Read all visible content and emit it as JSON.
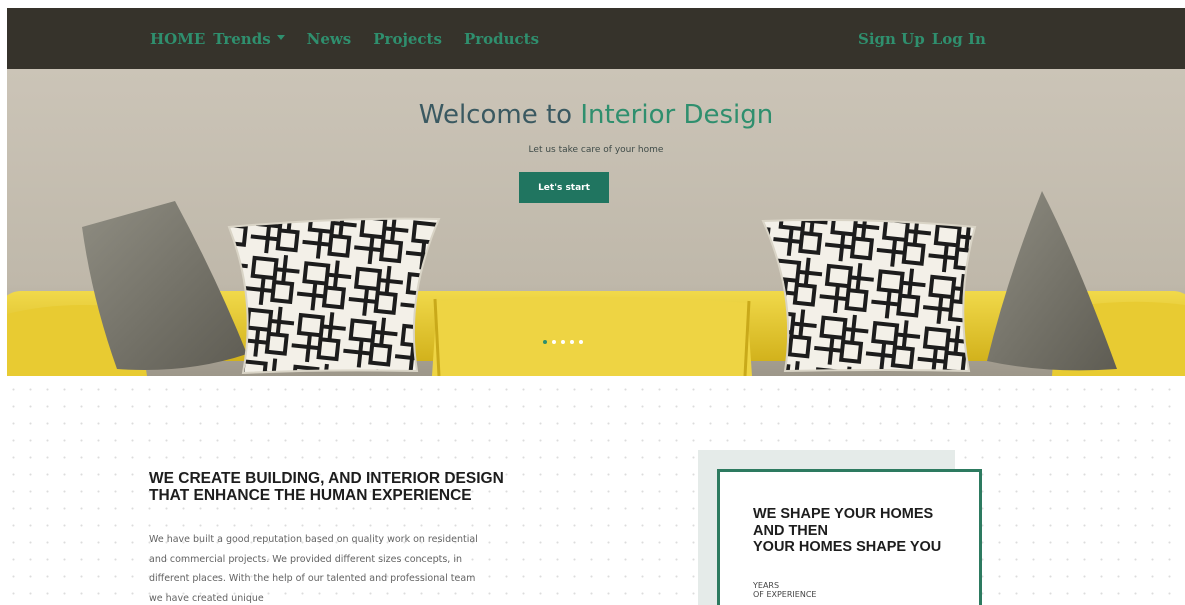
{
  "navbar": {
    "left_items": [
      {
        "label": "HOME",
        "dropdown": false
      },
      {
        "label": "Trends",
        "dropdown": true
      },
      {
        "label": "News",
        "dropdown": false
      },
      {
        "label": "Projects",
        "dropdown": false
      },
      {
        "label": "Products",
        "dropdown": false
      }
    ],
    "right_items": [
      {
        "label": "Sign Up"
      },
      {
        "label": "Log In"
      }
    ],
    "background_color": "#36332b",
    "link_color": "#2f8f6e"
  },
  "hero": {
    "title_prefix": "Welcome to",
    "title_accent": "Interior Design",
    "subtitle": "Let us take care of your home",
    "button_label": "Let's start",
    "carousel": {
      "slide_count": 5,
      "active_slide": 1
    },
    "accent_color": "#2f8f6e"
  },
  "about": {
    "title_lines": [
      "WE CREATE BUILDING, AND INTERIOR DESIGN",
      "THAT ENHANCE THE HUMAN EXPERIENCE"
    ],
    "body": "We have built a good reputation based on quality work on residential and commercial projects. We provided different sizes concepts, in different places. With the help of our talented and professional team we have created unique"
  },
  "shape_card": {
    "title_lines": [
      "WE SHAPE YOUR HOMES",
      "AND THEN",
      "YOUR HOMES SHAPE YOU"
    ],
    "caption_lines": [
      "YEARS",
      "OF EXPERIENCE"
    ],
    "border_color": "#2d7a60"
  }
}
